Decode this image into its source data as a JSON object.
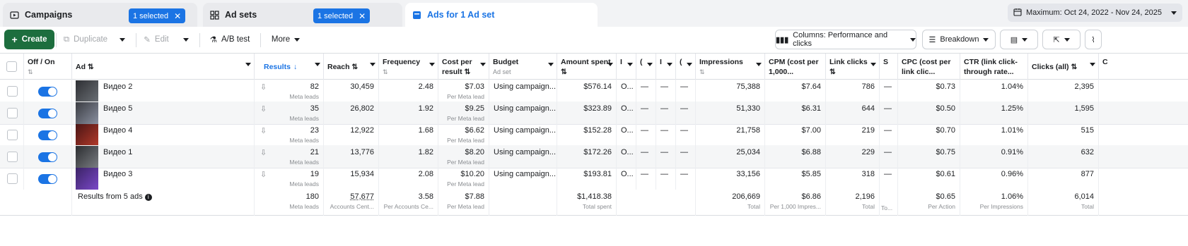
{
  "tabs": {
    "campaigns": {
      "label": "Campaigns",
      "selected": "1 selected"
    },
    "adsets": {
      "label": "Ad sets",
      "selected": "1 selected"
    },
    "ads": {
      "label": "Ads for 1 Ad set"
    }
  },
  "date_range": "Maximum: Oct 24, 2022 - Nov 24, 2025",
  "toolbar": {
    "create": "Create",
    "duplicate": "Duplicate",
    "edit": "Edit",
    "ab_test": "A/B test",
    "more": "More",
    "columns": "Columns: Performance and clicks",
    "breakdown": "Breakdown"
  },
  "headers": {
    "offon": "Off / On",
    "ad": "Ad",
    "results": "Results",
    "reach": "Reach",
    "frequency": "Frequency",
    "cpr": "Cost per result",
    "budget": "Budget",
    "budget_sub": "Ad set",
    "amount": "Amount spent",
    "c1": "I",
    "c2": "(",
    "c3": "I",
    "c4": "(",
    "impressions": "Impressions",
    "cpm": "CPM (cost per 1,000...",
    "link_clicks": "Link clicks",
    "s": "S",
    "cpc": "CPC (cost per link clic...",
    "ctr": "CTR (link click-through rate...",
    "clicks_all": "Clicks (all)",
    "c_end": "C"
  },
  "rows": [
    {
      "name": "Видео 2",
      "results": "82",
      "results_sub": "Meta leads",
      "reach": "30,459",
      "frequency": "2.48",
      "cpr": "$7.03",
      "cpr_sub": "Per Meta lead",
      "budget": "Using campaign...",
      "amount": "$576.14",
      "c1": "O...",
      "c2": "—",
      "c3": "—",
      "c4": "—",
      "impressions": "75,388",
      "cpm": "$7.64",
      "link_clicks": "786",
      "s": "—",
      "cpc": "$0.73",
      "ctr": "1.04%",
      "clicks_all": "2,395"
    },
    {
      "name": "Видео 5",
      "results": "35",
      "results_sub": "Meta leads",
      "reach": "26,802",
      "frequency": "1.92",
      "cpr": "$9.25",
      "cpr_sub": "Per Meta lead",
      "budget": "Using campaign...",
      "amount": "$323.89",
      "c1": "O...",
      "c2": "—",
      "c3": "—",
      "c4": "—",
      "impressions": "51,330",
      "cpm": "$6.31",
      "link_clicks": "644",
      "s": "—",
      "cpc": "$0.50",
      "ctr": "1.25%",
      "clicks_all": "1,595"
    },
    {
      "name": "Видео 4",
      "results": "23",
      "results_sub": "Meta leads",
      "reach": "12,922",
      "frequency": "1.68",
      "cpr": "$6.62",
      "cpr_sub": "Per Meta lead",
      "budget": "Using campaign...",
      "amount": "$152.28",
      "c1": "O...",
      "c2": "—",
      "c3": "—",
      "c4": "—",
      "impressions": "21,758",
      "cpm": "$7.00",
      "link_clicks": "219",
      "s": "—",
      "cpc": "$0.70",
      "ctr": "1.01%",
      "clicks_all": "515"
    },
    {
      "name": "Видео 1",
      "results": "21",
      "results_sub": "Meta leads",
      "reach": "13,776",
      "frequency": "1.82",
      "cpr": "$8.20",
      "cpr_sub": "Per Meta lead",
      "budget": "Using campaign...",
      "amount": "$172.26",
      "c1": "O...",
      "c2": "—",
      "c3": "—",
      "c4": "—",
      "impressions": "25,034",
      "cpm": "$6.88",
      "link_clicks": "229",
      "s": "—",
      "cpc": "$0.75",
      "ctr": "0.91%",
      "clicks_all": "632"
    },
    {
      "name": "Видео 3",
      "results": "19",
      "results_sub": "Meta leads",
      "reach": "15,934",
      "frequency": "2.08",
      "cpr": "$10.20",
      "cpr_sub": "Per Meta lead",
      "budget": "Using campaign...",
      "amount": "$193.81",
      "c1": "O...",
      "c2": "—",
      "c3": "—",
      "c4": "—",
      "impressions": "33,156",
      "cpm": "$5.85",
      "link_clicks": "318",
      "s": "—",
      "cpc": "$0.61",
      "ctr": "0.96%",
      "clicks_all": "877"
    }
  ],
  "totals": {
    "label": "Results from 5 ads",
    "results": "180",
    "results_sub": "Meta leads",
    "reach": "57,677",
    "reach_sub": "Accounts Cent...",
    "frequency": "3.58",
    "frequency_sub": "Per Accounts Ce...",
    "cpr": "$7.88",
    "cpr_sub": "Per Meta lead",
    "amount": "$1,418.38",
    "amount_sub": "Total spent",
    "impressions": "206,669",
    "impressions_sub": "Total",
    "cpm": "$6.86",
    "cpm_sub": "Per 1,000 Impres...",
    "link_clicks": "2,196",
    "link_clicks_sub": "Total",
    "s_sub": "To...",
    "cpc": "$0.65",
    "cpc_sub": "Per Action",
    "ctr": "1.06%",
    "ctr_sub": "Per Impressions",
    "clicks_all": "6,014",
    "clicks_all_sub": "Total"
  }
}
